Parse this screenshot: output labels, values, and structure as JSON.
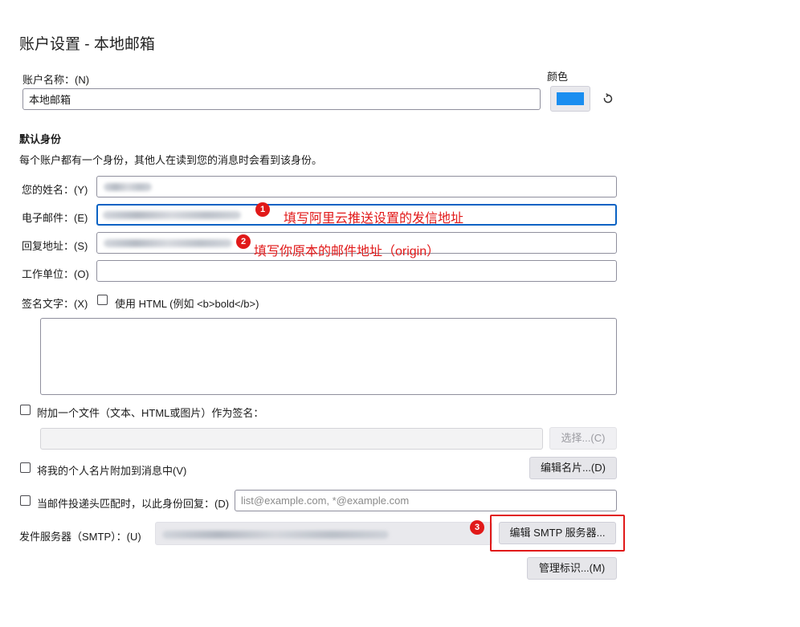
{
  "page_title": "账户设置 - 本地邮箱",
  "account": {
    "name_label": "账户名称：(N)",
    "name_value": "本地邮箱",
    "color_label": "颜色",
    "color_value": "#1a8ef0",
    "reset_icon": "reset-icon"
  },
  "identity": {
    "heading": "默认身份",
    "description": "每个账户都有一个身份，其他人在读到您的消息时会看到该身份。",
    "your_name_label": "您的姓名：(Y)",
    "email_label": "电子邮件：(E)",
    "reply_to_label": "回复地址：(S)",
    "organization_label": "工作单位：(O)",
    "signature_label": "签名文字：(X)",
    "use_html_label": "使用 HTML (例如 <b>bold</b>)",
    "attach_file_label": "附加一个文件（文本、HTML或图片）作为签名：",
    "choose_button": "选择...(C)",
    "attach_vcard_label": "将我的个人名片附加到消息中(V)",
    "edit_card_button": "编辑名片...(D)",
    "reply_match_label": "当邮件投递头匹配时，以此身份回复：(D)",
    "reply_match_placeholder": "list@example.com, *@example.com",
    "smtp_label": "发件服务器（SMTP）：(U)",
    "edit_smtp_button": "编辑 SMTP 服务器...",
    "manage_identities_button": "管理标识...(M)"
  },
  "annotations": {
    "badge_1": "1",
    "note_1": "填写阿里云推送设置的发信地址",
    "badge_2": "2",
    "note_2": "填写你原本的邮件地址（origin）",
    "badge_3": "3"
  }
}
